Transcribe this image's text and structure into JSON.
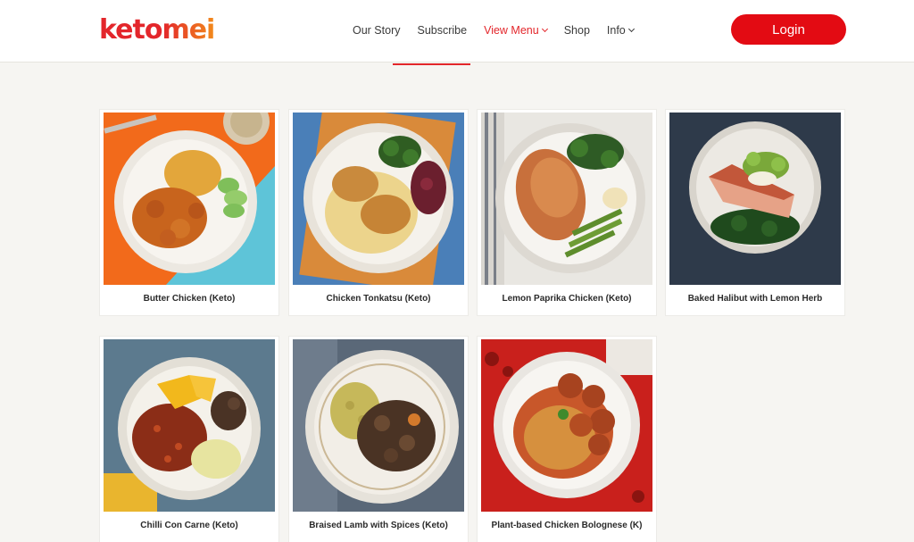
{
  "header": {
    "logo_text": "ketomei",
    "nav": [
      {
        "label": "Our Story",
        "dropdown": false,
        "active": false
      },
      {
        "label": "Subscribe",
        "dropdown": false,
        "active": false
      },
      {
        "label": "View Menu",
        "dropdown": true,
        "active": true
      },
      {
        "label": "Shop",
        "dropdown": false,
        "active": false
      },
      {
        "label": "Info",
        "dropdown": true,
        "active": false
      }
    ],
    "login_label": "Login"
  },
  "menu": {
    "items": [
      {
        "name": "Butter Chicken (Keto)",
        "image_icon": "butter-chicken-dish"
      },
      {
        "name": "Chicken Tonkatsu (Keto)",
        "image_icon": "chicken-tonkatsu-dish"
      },
      {
        "name": "Lemon Paprika Chicken (Keto)",
        "image_icon": "lemon-paprika-chicken-dish"
      },
      {
        "name": "Baked Halibut with Lemon Herb",
        "image_icon": "baked-halibut-dish"
      },
      {
        "name": "Chilli Con Carne (Keto)",
        "image_icon": "chilli-con-carne-dish"
      },
      {
        "name": "Braised Lamb with Spices (Keto)",
        "image_icon": "braised-lamb-dish"
      },
      {
        "name": "Plant-based Chicken Bolognese (K)",
        "image_icon": "bolognese-dish"
      }
    ]
  },
  "colors": {
    "brand_red": "#e30b13",
    "accent_orange": "#f28a1c",
    "page_bg": "#f6f5f2"
  }
}
